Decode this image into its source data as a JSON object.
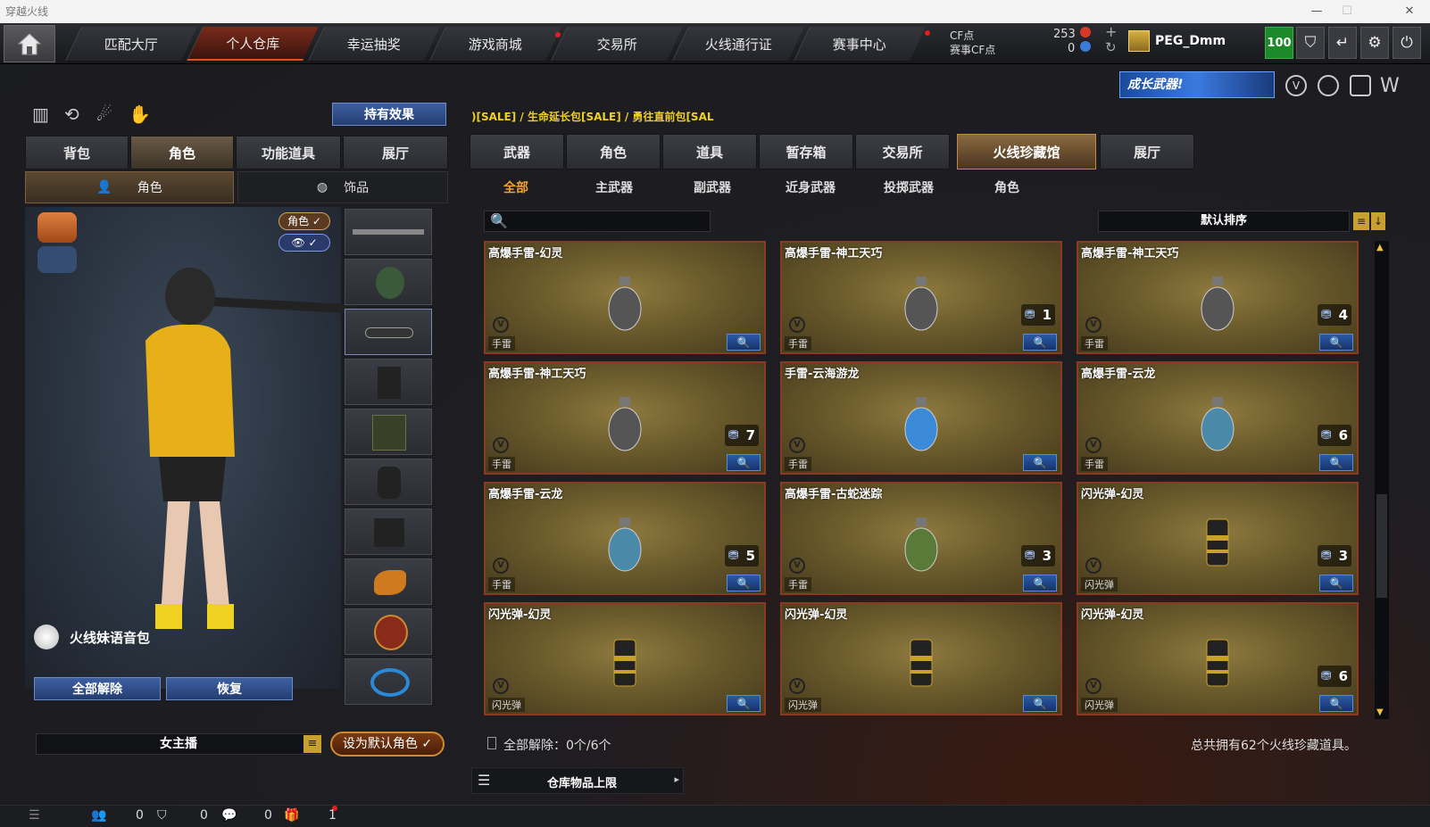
{
  "window": {
    "title": "穿越火线",
    "minimize": "—",
    "maximize": "☐",
    "close": "✕"
  },
  "topnav": {
    "tabs": [
      "匹配大厅",
      "个人仓库",
      "幸运抽奖",
      "游戏商城",
      "交易所",
      "火线通行证",
      "赛事中心"
    ],
    "active_index": 1,
    "cf_label": "CF点",
    "cf_value": "253",
    "event_cf_label": "赛事CF点",
    "event_cf_value": "0",
    "plus": "+",
    "refresh": "↻",
    "username": "PEG_Dmm",
    "level": "100"
  },
  "banner": {
    "text": "成长武器!"
  },
  "ticker": ")[SALE] / 生命延长包[SALE] / 勇往直前包[SAL",
  "left": {
    "effects_button": "持有效果",
    "tabs": [
      "背包",
      "角色",
      "功能道具",
      "展厅"
    ],
    "active_tab": 1,
    "subtabs": [
      "角色",
      "饰品"
    ],
    "role_badge": "角色 ✓",
    "eye_badge": "👁 ✓",
    "voice_pack": "火线妹语音包",
    "unequip_all": "全部解除",
    "restore": "恢复",
    "character_name": "女主播",
    "set_default": "设为默认角色 ✓"
  },
  "right": {
    "tabs": [
      "武器",
      "角色",
      "道具",
      "暂存箱",
      "交易所",
      "火线珍藏馆",
      "展厅"
    ],
    "active_tab": 5,
    "subtabs": [
      "全部",
      "主武器",
      "副武器",
      "近身武器",
      "投掷武器",
      "角色"
    ],
    "active_subtab": 0,
    "search_placeholder": "",
    "sort_label": "默认排序",
    "items": [
      {
        "name": "高爆手雷-幻灵",
        "category": "手雷",
        "count": "",
        "icon": "grenade-phantom"
      },
      {
        "name": "高爆手雷-神工天巧",
        "category": "手雷",
        "count": "1",
        "icon": "grenade-craft"
      },
      {
        "name": "高爆手雷-神工天巧",
        "category": "手雷",
        "count": "4",
        "icon": "grenade-craft"
      },
      {
        "name": "高爆手雷-神工天巧",
        "category": "手雷",
        "count": "7",
        "icon": "grenade-craft"
      },
      {
        "name": "手雷-云海游龙",
        "category": "手雷",
        "count": "",
        "icon": "grenade-dragon-sea"
      },
      {
        "name": "高爆手雷-云龙",
        "category": "手雷",
        "count": "6",
        "icon": "grenade-cloud-dragon"
      },
      {
        "name": "高爆手雷-云龙",
        "category": "手雷",
        "count": "5",
        "icon": "grenade-cloud-dragon"
      },
      {
        "name": "高爆手雷-古蛇迷踪",
        "category": "手雷",
        "count": "3",
        "icon": "grenade-snake"
      },
      {
        "name": "闪光弹-幻灵",
        "category": "闪光弹",
        "count": "3",
        "icon": "flashbang-phantom"
      },
      {
        "name": "闪光弹-幻灵",
        "category": "闪光弹",
        "count": "",
        "icon": "flashbang-phantom"
      },
      {
        "name": "闪光弹-幻灵",
        "category": "闪光弹",
        "count": "",
        "icon": "flashbang-phantom"
      },
      {
        "name": "闪光弹-幻灵",
        "category": "闪光弹",
        "count": "6",
        "icon": "flashbang-phantom"
      }
    ],
    "unequip_status": "全部解除：0个/6个",
    "total": "总共拥有62个火线珍藏道具。",
    "storage_limit": "仓库物品上限"
  },
  "statusbar": {
    "friends": "0",
    "guild": "0",
    "chat": "0",
    "gifts": "1"
  }
}
